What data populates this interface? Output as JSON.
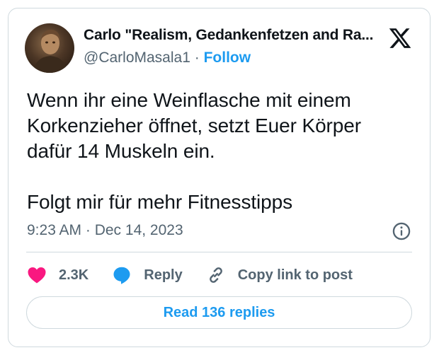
{
  "author": {
    "name": "Carlo \"Realism, Gedankenfetzen and Ra...",
    "handle": "@CarloMasala1",
    "separator": "·",
    "follow_label": "Follow"
  },
  "tweet": {
    "text": "Wenn ihr eine Weinflasche mit einem\nKorkenzieher öffnet, setzt Euer Körper\ndafür 14 Muskeln ein.\n\nFolgt mir für mehr Fitnesstipps",
    "timestamp": "9:23 AM · Dec 14, 2023"
  },
  "actions": {
    "like_count": "2.3K",
    "reply_label": "Reply",
    "copy_link_label": "Copy link to post"
  },
  "read_replies_label": "Read 136 replies",
  "icons": [
    "x-logo-icon",
    "info-icon",
    "heart-icon",
    "reply-bubble-icon",
    "link-icon"
  ],
  "colors": {
    "accent": "#1d9bf0",
    "like": "#f91880",
    "text": "#0f1419",
    "secondary": "#536471",
    "border": "#cfd9de"
  }
}
